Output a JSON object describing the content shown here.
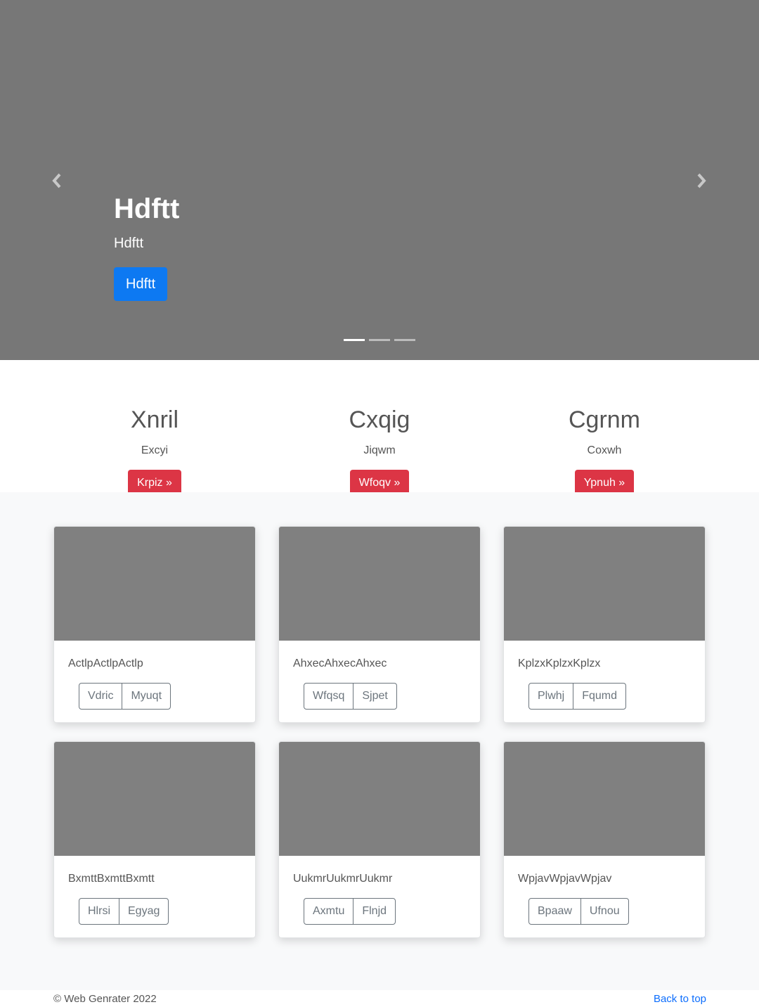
{
  "carousel": {
    "slides": [
      {
        "title": "Hdftt",
        "subtitle": "Hdftt",
        "button": "Hdftt"
      }
    ],
    "indicator_count": 3,
    "active_indicator": 0
  },
  "features": [
    {
      "heading": "Xnril",
      "text": "Excyi",
      "button": "Krpiz »"
    },
    {
      "heading": "Cxqig",
      "text": "Jiqwm",
      "button": "Wfoqv »"
    },
    {
      "heading": "Cgrnm",
      "text": "Coxwh",
      "button": "Ypnuh »"
    }
  ],
  "cards": [
    {
      "text": "ActlpActlpActlp",
      "buttons": [
        "Vdric",
        "Myuqt"
      ]
    },
    {
      "text": "AhxecAhxecAhxec",
      "buttons": [
        "Wfqsq",
        "Sjpet"
      ]
    },
    {
      "text": "KplzxKplzxKplzx",
      "buttons": [
        "Plwhj",
        "Fqumd"
      ]
    },
    {
      "text": "BxmttBxmttBxmtt",
      "buttons": [
        "Hlrsi",
        "Egyag"
      ]
    },
    {
      "text": "UukmrUukmrUukmr",
      "buttons": [
        "Axmtu",
        "Flnjd"
      ]
    },
    {
      "text": "WpjavWpjavWpjav",
      "buttons": [
        "Bpaaw",
        "Ufnou"
      ]
    }
  ],
  "footer": {
    "copyright": "© Web Genrater 2022",
    "back_to_top": "Back to top"
  },
  "colors": {
    "carousel_bg": "#777777",
    "primary": "#0d79f2",
    "danger": "#dc3545",
    "thumb": "#808080",
    "link": "#0d6efd"
  }
}
